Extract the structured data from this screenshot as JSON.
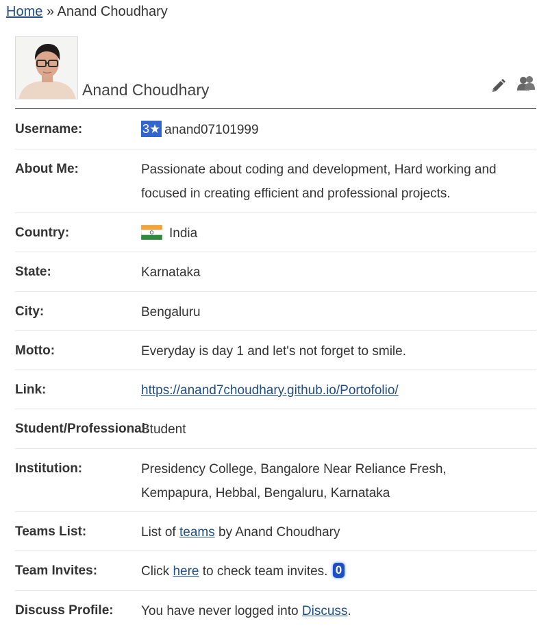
{
  "breadcrumb": {
    "home": "Home",
    "separator": "»",
    "current": "Anand Choudhary"
  },
  "profile": {
    "name": "Anand Choudhary"
  },
  "icons": {
    "edit": "pencil-icon",
    "friends": "users-icon"
  },
  "details": {
    "username": {
      "label": "Username:",
      "stars": "3★",
      "value": "anand07101999"
    },
    "about": {
      "label": "About Me:",
      "line1": "Passionate about coding and development, Hard working and",
      "line2": "focused in creating efficient and professional projects."
    },
    "country": {
      "label": "Country:",
      "value": "India"
    },
    "state": {
      "label": "State:",
      "value": "Karnataka"
    },
    "city": {
      "label": "City:",
      "value": "Bengaluru"
    },
    "motto": {
      "label": "Motto:",
      "value": "Everyday is day 1 and let's not forget to smile."
    },
    "link": {
      "label": "Link:",
      "value": "https://anand7choudhary.github.io/Portofolio/"
    },
    "student": {
      "label": "Student/Professional:",
      "value": "Student"
    },
    "institution": {
      "label": "Institution:",
      "line1": "Presidency College, Bangalore Near Reliance Fresh,",
      "line2": "Kempapura, Hebbal, Bengaluru, Karnataka"
    },
    "teams": {
      "label": "Teams List:",
      "prefix": "List of",
      "link": "teams",
      "suffix": "by Anand Choudhary"
    },
    "invites": {
      "label": "Team Invites:",
      "prefix": "Click",
      "link": "here",
      "suffix": "to check team invites.",
      "count": "0"
    },
    "discuss": {
      "label": "Discuss Profile:",
      "prefix": "You have never logged into",
      "link": "Discuss",
      "suffix": "."
    }
  },
  "colors": {
    "link": "#1f4d85",
    "star_badge": "#3366cc",
    "invite_badge": "#1e4fc2"
  }
}
